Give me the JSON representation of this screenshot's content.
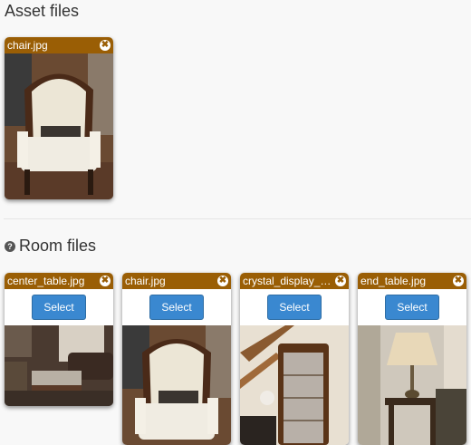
{
  "asset_section": {
    "title": "Asset files",
    "files": [
      {
        "name": "chair.jpg"
      }
    ]
  },
  "room_section": {
    "title": "Room files",
    "help_icon": "question-icon",
    "select_label": "Select",
    "files": [
      {
        "name": "center_table.jpg"
      },
      {
        "name": "chair.jpg"
      },
      {
        "name": "crystal_display_c..."
      },
      {
        "name": "end_table.jpg"
      }
    ]
  },
  "colors": {
    "card_header": "#9a5e05",
    "select_button": "#3a88d0"
  }
}
